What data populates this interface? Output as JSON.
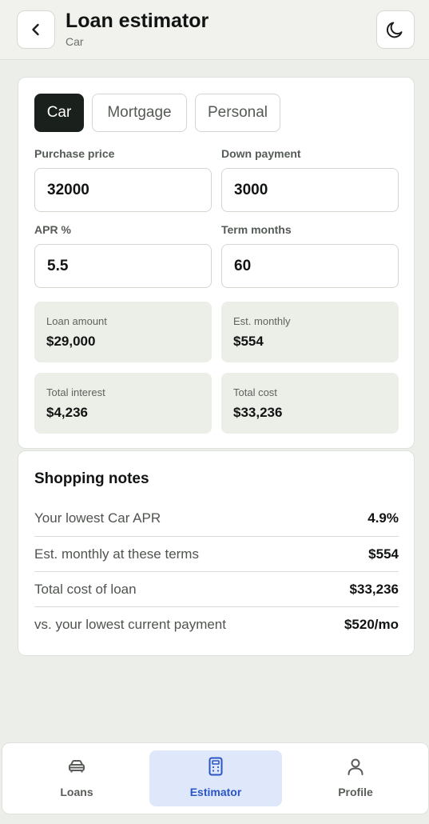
{
  "header": {
    "title": "Loan estimator",
    "subtitle": "Car",
    "back_icon": "chevron-left-icon",
    "theme_icon": "moon-icon"
  },
  "tabs": [
    {
      "label": "Car",
      "active": true
    },
    {
      "label": "Mortgage",
      "active": false
    },
    {
      "label": "Personal",
      "active": false
    }
  ],
  "fields": {
    "purchase_price": {
      "label": "Purchase price",
      "value": "32000"
    },
    "down_payment": {
      "label": "Down payment",
      "value": "3000"
    },
    "apr": {
      "label": "APR %",
      "value": "5.5"
    },
    "term": {
      "label": "Term months",
      "value": "60"
    }
  },
  "stats": {
    "loan_amount": {
      "label": "Loan amount",
      "value": "$29,000"
    },
    "est_monthly": {
      "label": "Est. monthly",
      "value": "$554"
    },
    "total_interest": {
      "label": "Total interest",
      "value": "$4,236"
    },
    "total_cost": {
      "label": "Total cost",
      "value": "$33,236"
    }
  },
  "notes": {
    "title": "Shopping notes",
    "rows": [
      {
        "label": "Your lowest Car APR",
        "value": "4.9%"
      },
      {
        "label": "Est. monthly at these terms",
        "value": "$554"
      },
      {
        "label": "Total cost of loan",
        "value": "$33,236"
      },
      {
        "label": "vs. your lowest current payment",
        "value": "$520/mo"
      }
    ]
  },
  "nav": {
    "items": [
      {
        "label": "Loans",
        "icon": "car-icon",
        "active": false
      },
      {
        "label": "Estimator",
        "icon": "calculator-icon",
        "active": true
      },
      {
        "label": "Profile",
        "icon": "user-icon",
        "active": false
      }
    ]
  },
  "colors": {
    "accent": "#2a55c4",
    "active_tab": "#1a201c",
    "active_nav_bg": "#dfe8fb"
  }
}
